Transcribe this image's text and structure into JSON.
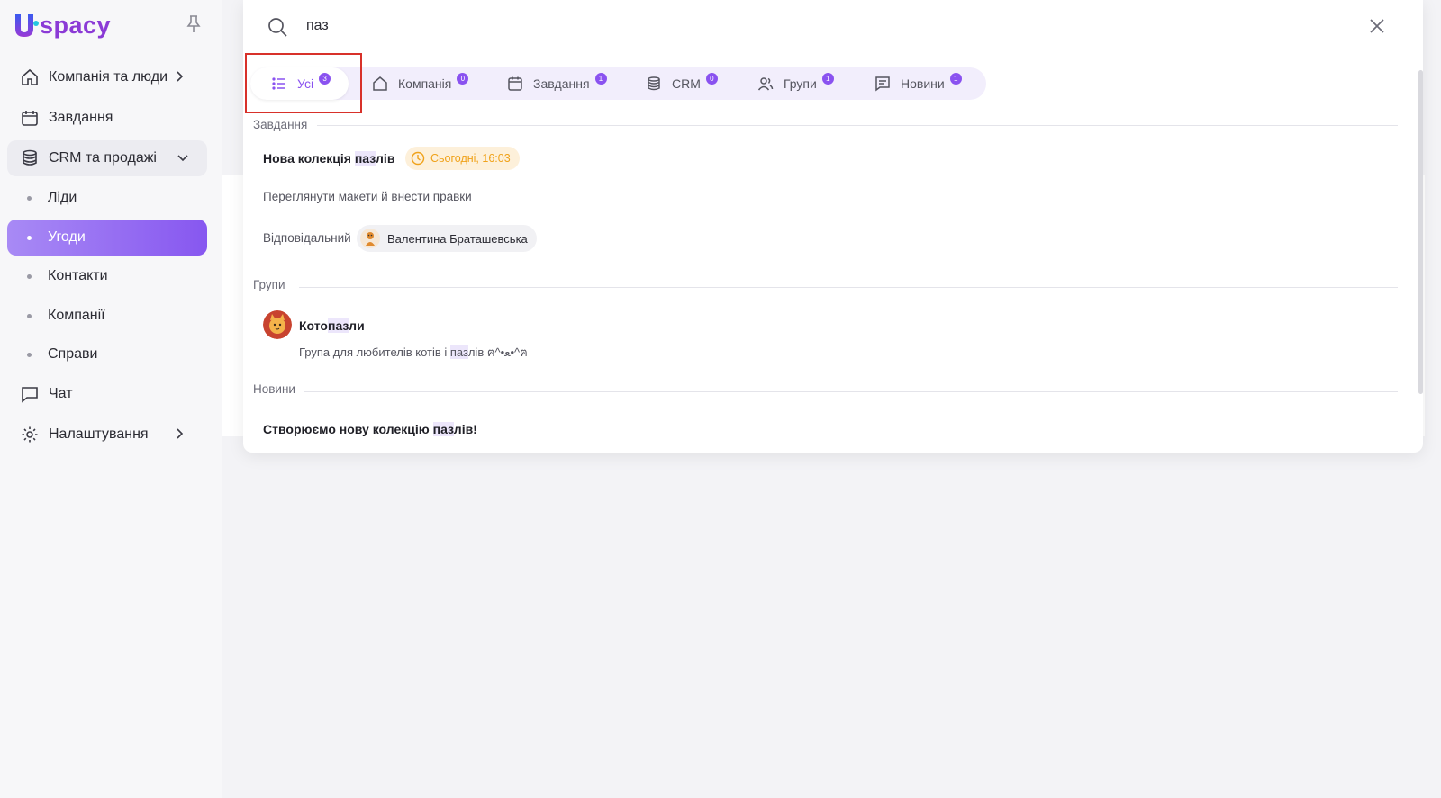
{
  "sidebar": {
    "logo_text": "spacy",
    "logo_letter": "U",
    "items": [
      {
        "label": "Компанія та люди"
      },
      {
        "label": "Завдання"
      },
      {
        "label": "CRM та продажі"
      },
      {
        "label": "Чат"
      },
      {
        "label": "Налаштування"
      }
    ],
    "sub_items": [
      {
        "label": "Ліди"
      },
      {
        "label": "Угоди"
      },
      {
        "label": "Контакти"
      },
      {
        "label": "Компанії"
      },
      {
        "label": "Справи"
      }
    ]
  },
  "search": {
    "value": "паз"
  },
  "tabs": [
    {
      "label": "Усі",
      "count": "3"
    },
    {
      "label": "Компанія",
      "count": "0"
    },
    {
      "label": "Завдання",
      "count": "1"
    },
    {
      "label": "CRM",
      "count": "0"
    },
    {
      "label": "Групи",
      "count": "1"
    },
    {
      "label": "Новини",
      "count": "1"
    }
  ],
  "results": {
    "tasks": {
      "section": "Завдання",
      "title_pre": "Нова колекція ",
      "title_match": "паз",
      "title_post": "лів",
      "time": "Сьогодні, 16:03",
      "description": "Переглянути макети й внести правки",
      "responsible_label": "Відповідальний",
      "responsible_name": "Валентина Браташевська"
    },
    "groups": {
      "section": "Групи",
      "name_pre": "Кото",
      "name_match": "паз",
      "name_post": "ли",
      "desc_pre": "Група для любителів котів і ",
      "desc_match": "паз",
      "desc_post": "лів ฅ^•ﻌ•^ฅ"
    },
    "news": {
      "section": "Новини",
      "title_pre": "Створюємо нову колекцію ",
      "title_match": "паз",
      "title_post": "лів!"
    }
  },
  "colors": {
    "accent": "#8a52f0",
    "active_gradient_start": "#a88af5",
    "active_gradient_end": "#8757f0",
    "highlight_border": "#d8312a",
    "time_chip_text": "#f0a21a"
  }
}
